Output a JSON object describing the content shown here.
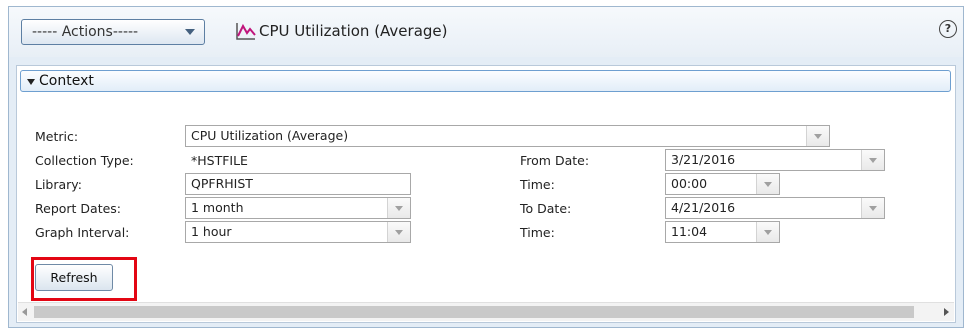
{
  "toolbar": {
    "actions_label": "----- Actions-----",
    "title": "CPU Utilization (Average)",
    "help_label": "?"
  },
  "context": {
    "header": "Context",
    "metric": {
      "label": "Metric:",
      "value": "CPU Utilization (Average)"
    },
    "collection_type": {
      "label": "Collection Type:",
      "value": "*HSTFILE"
    },
    "library": {
      "label": "Library:",
      "value": "QPFRHIST"
    },
    "report_dates": {
      "label": "Report Dates:",
      "value": "1 month"
    },
    "graph_interval": {
      "label": "Graph Interval:",
      "value": "1 hour"
    },
    "from_date": {
      "label": "From Date:",
      "value": "3/21/2016"
    },
    "from_time": {
      "label": "Time:",
      "value": "00:00"
    },
    "to_date": {
      "label": "To Date:",
      "value": "4/21/2016"
    },
    "to_time": {
      "label": "Time:",
      "value": "11:04"
    },
    "refresh_label": "Refresh"
  },
  "colors": {
    "accent": "#5d7fa3",
    "highlight": "#e30613",
    "chart_icon": "#c0157b"
  }
}
